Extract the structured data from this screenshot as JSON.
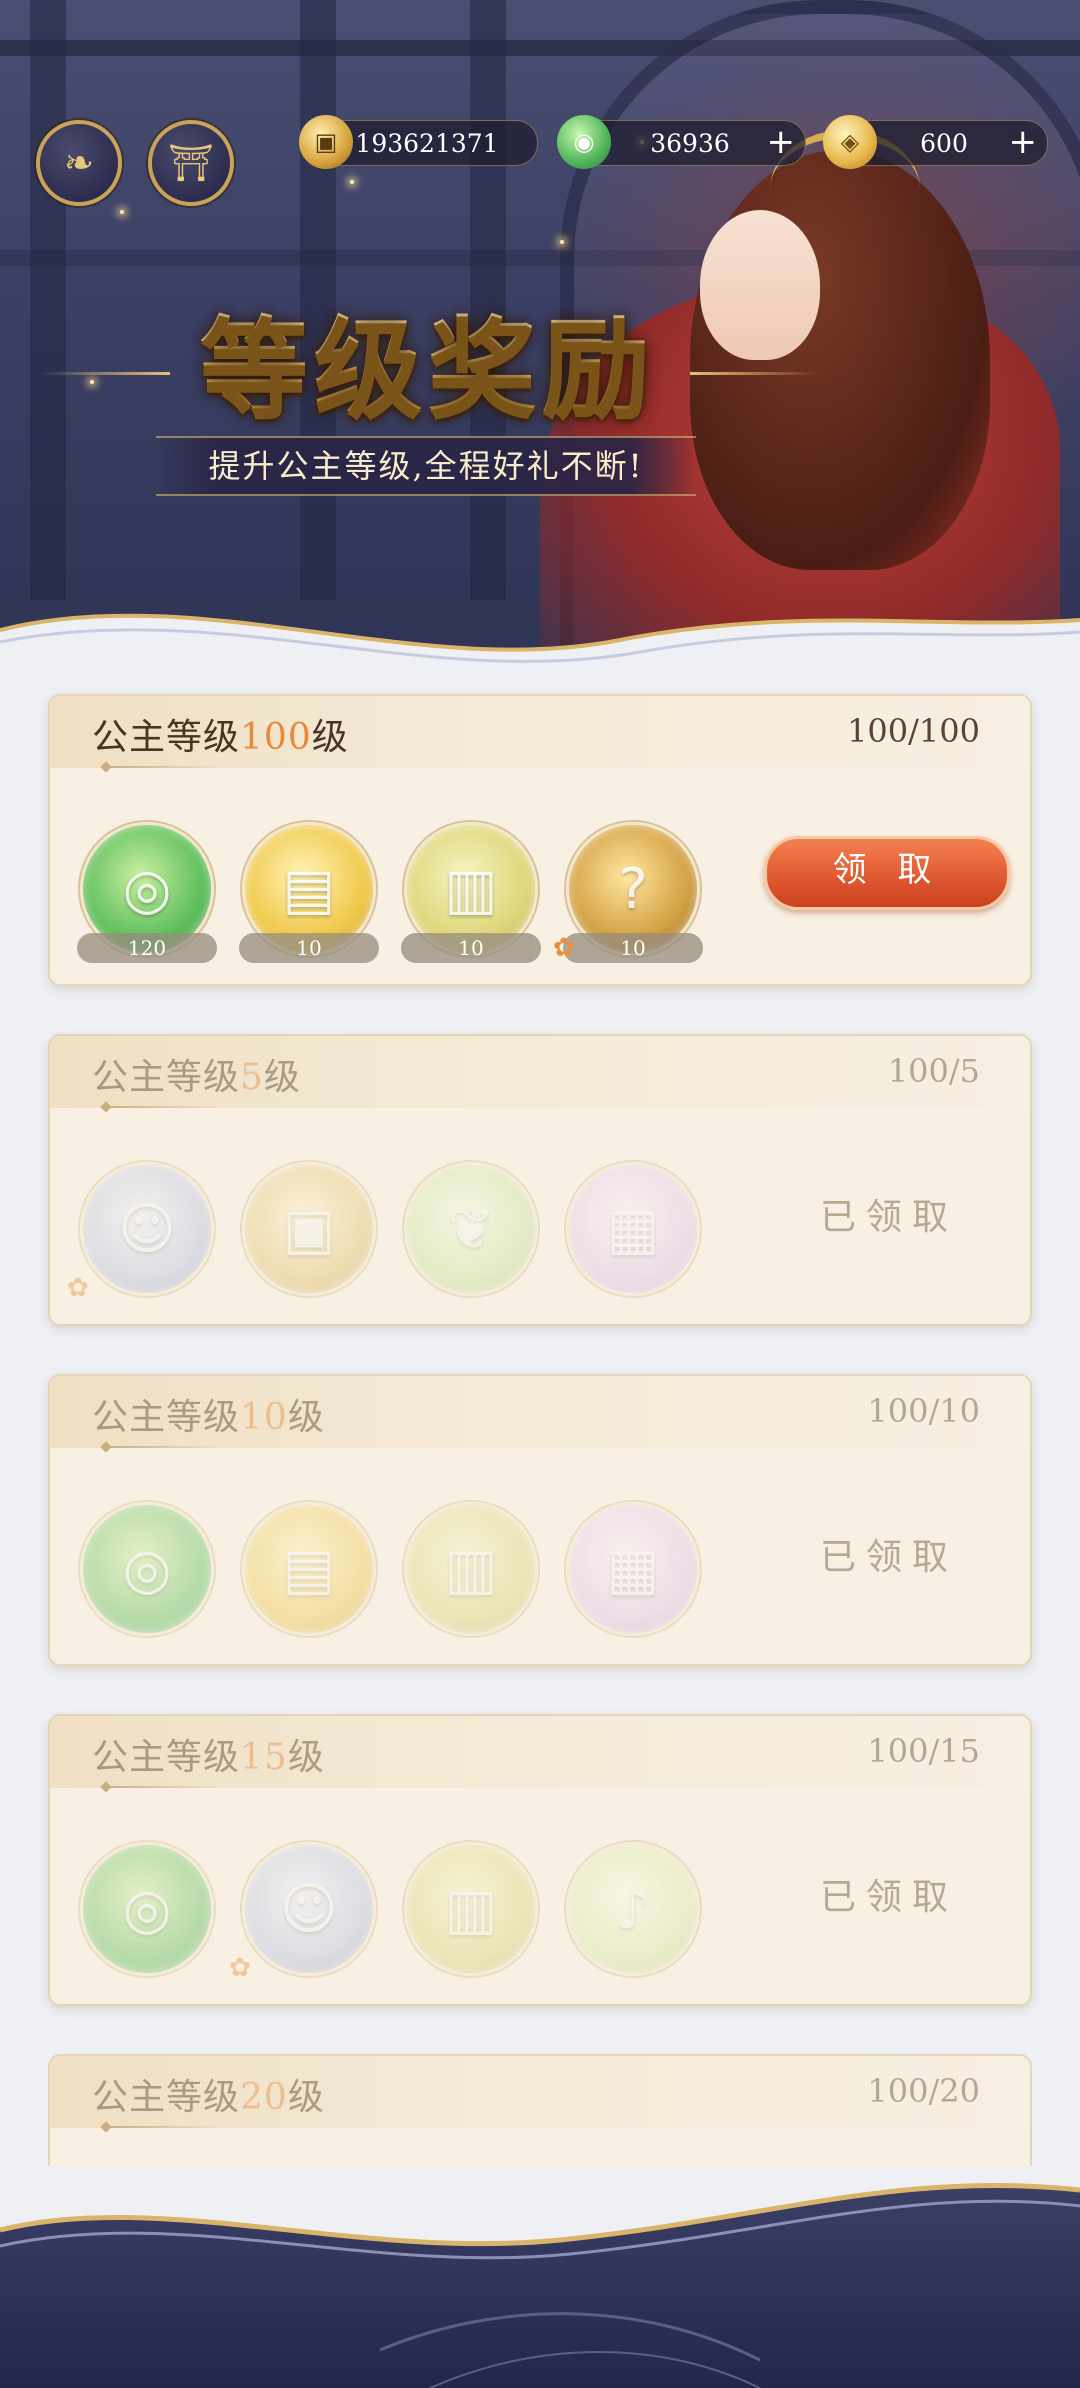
{
  "header": {
    "resources": [
      {
        "name": "copper-coin",
        "value": "193621371",
        "has_plus": false
      },
      {
        "name": "jade",
        "value": "36936",
        "has_plus": true
      },
      {
        "name": "gold-ingot",
        "value": "600",
        "has_plus": true
      }
    ],
    "plus_symbol": "+"
  },
  "banner": {
    "title": "等级奖励",
    "subtitle": "提升公主等级,全程好礼不断!"
  },
  "cards": [
    {
      "label_prefix": "公主等级",
      "level": "100",
      "label_suffix": "级",
      "progress": "100/100",
      "status": "claimable",
      "action_label": "领 取",
      "items": [
        {
          "icon": "jade-pendant",
          "count": "120"
        },
        {
          "icon": "gold-scroll",
          "count": "10"
        },
        {
          "icon": "bamboo-scroll",
          "count": "10"
        },
        {
          "icon": "mystery-chest",
          "count": "10"
        }
      ]
    },
    {
      "label_prefix": "公主等级",
      "level": "5",
      "label_suffix": "级",
      "progress": "100/5",
      "status": "claimed",
      "action_label": "已领取",
      "items": [
        {
          "icon": "companion-portrait"
        },
        {
          "icon": "copper-coin"
        },
        {
          "icon": "tea-leaf"
        },
        {
          "icon": "book"
        }
      ]
    },
    {
      "label_prefix": "公主等级",
      "level": "10",
      "label_suffix": "级",
      "progress": "100/10",
      "status": "claimed",
      "action_label": "已领取",
      "items": [
        {
          "icon": "jade-pendant"
        },
        {
          "icon": "gold-scroll"
        },
        {
          "icon": "bamboo-scroll"
        },
        {
          "icon": "book"
        }
      ]
    },
    {
      "label_prefix": "公主等级",
      "level": "15",
      "label_suffix": "级",
      "progress": "100/15",
      "status": "claimed",
      "action_label": "已领取",
      "items": [
        {
          "icon": "jade-pendant"
        },
        {
          "icon": "companion-portrait"
        },
        {
          "icon": "bamboo-scroll"
        },
        {
          "icon": "bell"
        }
      ]
    },
    {
      "label_prefix": "公主等级",
      "level": "20",
      "label_suffix": "级",
      "progress": "100/20",
      "status": "partial"
    }
  ],
  "colors": {
    "level_accent": "#e9893a",
    "claim_button": "#e25a33",
    "claimed_text": "#b7a892",
    "card_bg": "#f7f0e3",
    "page_bg": "#eff0f4"
  }
}
